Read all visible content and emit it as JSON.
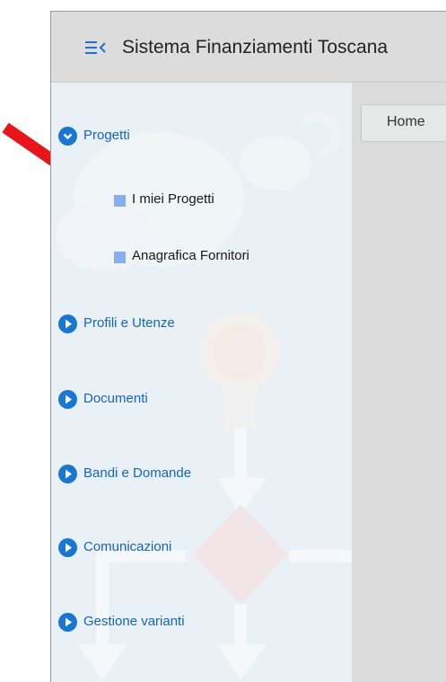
{
  "header": {
    "title": "Sistema Finanziamenti Toscana",
    "menu_icon": "menu-collapse-icon"
  },
  "content": {
    "home_tab": "Home"
  },
  "sidebar": {
    "items": [
      {
        "label": "Progetti",
        "icon": "chevron-down-circle-icon",
        "expanded": true,
        "children": [
          {
            "label": "I miei Progetti",
            "icon": "square-bullet-icon"
          },
          {
            "label": "Anagrafica Fornitori",
            "icon": "square-bullet-icon"
          }
        ]
      },
      {
        "label": "Profili e Utenze",
        "icon": "chevron-right-circle-icon",
        "expanded": false
      },
      {
        "label": "Documenti",
        "icon": "chevron-right-circle-icon",
        "expanded": false
      },
      {
        "label": "Bandi e Domande",
        "icon": "chevron-right-circle-icon",
        "expanded": false
      },
      {
        "label": "Comunicazioni",
        "icon": "chevron-right-circle-icon",
        "expanded": false
      },
      {
        "label": "Gestione varianti",
        "icon": "chevron-right-circle-icon",
        "expanded": false
      }
    ]
  },
  "colors": {
    "accent": "#1877d2",
    "menu_text": "#1565c0",
    "bullet": "#86aef0",
    "annotation_arrow": "#e8161b"
  }
}
